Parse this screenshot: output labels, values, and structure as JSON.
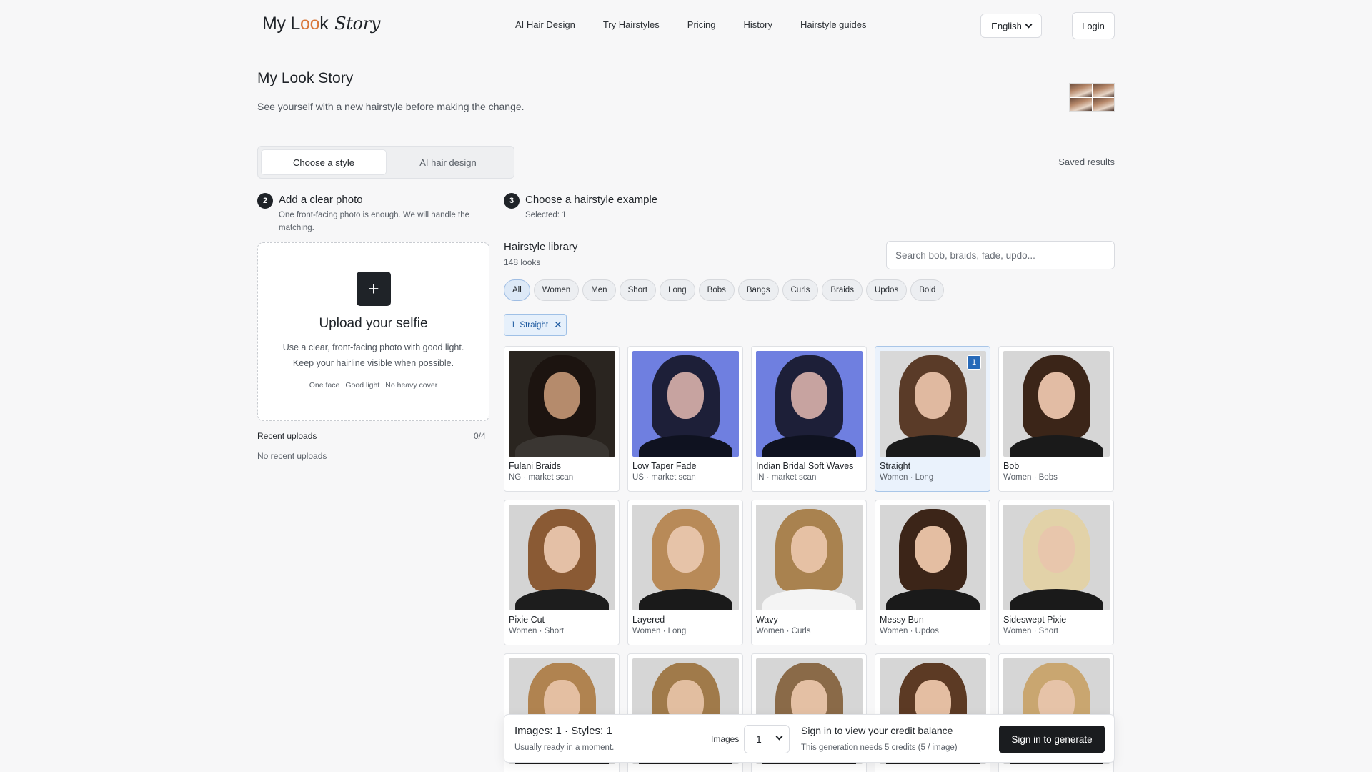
{
  "brand": {
    "logo_pre": "My L",
    "logo_oo": "oo",
    "logo_post": "k",
    "logo_story": "Story"
  },
  "nav": {
    "links": [
      "AI Hair Design",
      "Try Hairstyles",
      "Pricing",
      "History",
      "Hairstyle guides"
    ],
    "language": "English",
    "login": "Login"
  },
  "hero": {
    "title": "My Look Story",
    "subtitle": "See yourself with a new hairstyle before making the change."
  },
  "tabs": {
    "choose": "Choose a style",
    "ai": "AI hair design",
    "saved": "Saved results"
  },
  "step2": {
    "num": "2",
    "title": "Add a clear photo",
    "desc": "One front-facing photo is enough. We will handle the matching."
  },
  "step3": {
    "num": "3",
    "title": "Choose a hairstyle example",
    "selected": "Selected: 1"
  },
  "upload": {
    "plus": "+",
    "title": "Upload your selfie",
    "desc": "Use a clear, front-facing photo with good light. Keep your hairline visible when possible.",
    "tags": [
      "One face",
      "Good light",
      "No heavy cover"
    ]
  },
  "recent": {
    "label": "Recent uploads",
    "count": "0/4",
    "empty": "No recent uploads"
  },
  "library": {
    "title": "Hairstyle library",
    "count": "148 looks",
    "search_placeholder": "Search bob, braids, fade, updo...",
    "chips": [
      "All",
      "Women",
      "Men",
      "Short",
      "Long",
      "Bobs",
      "Bangs",
      "Curls",
      "Braids",
      "Updos",
      "Bold"
    ],
    "active_chip": "All",
    "selected_pill": {
      "num": "1",
      "label": "Straight"
    }
  },
  "cards": [
    {
      "name": "Fulani Braids",
      "meta": "NG · market scan",
      "bg": "#2a2520",
      "hair": "#1c1410",
      "face": "#b58b6c",
      "body": "#3a3632"
    },
    {
      "name": "Low Taper Fade",
      "meta": "US · market scan",
      "bg": "#6f7fe0",
      "hair": "#1d1f38",
      "face": "#c7a3a0",
      "body": "#0f1220"
    },
    {
      "name": "Indian Bridal Soft Waves",
      "meta": "IN · market scan",
      "bg": "#6f7fe0",
      "hair": "#1d1f38",
      "face": "#c7a3a0",
      "body": "#0f1220"
    },
    {
      "name": "Straight",
      "meta": "Women · Long",
      "bg": "#d8d8d8",
      "hair": "#5a3b28",
      "face": "#e0b9a0",
      "body": "#1a1a1a",
      "badge": "1",
      "selected": true
    },
    {
      "name": "Bob",
      "meta": "Women · Bobs",
      "bg": "#d6d6d6",
      "hair": "#3b2518",
      "face": "#e2bca4",
      "body": "#1a1a1a"
    },
    {
      "name": "Pixie Cut",
      "meta": "Women · Short",
      "bg": "#d4d4d4",
      "hair": "#8a5a34",
      "face": "#e4c0a6",
      "body": "#1d1d1d"
    },
    {
      "name": "Layered",
      "meta": "Women · Long",
      "bg": "#d6d6d6",
      "hair": "#b88a58",
      "face": "#e6c3a8",
      "body": "#1a1a1a"
    },
    {
      "name": "Wavy",
      "meta": "Women · Curls",
      "bg": "#d8d8d8",
      "hair": "#a9824f",
      "face": "#e6c1a4",
      "body": "#f4f4f4"
    },
    {
      "name": "Messy Bun",
      "meta": "Women · Updos",
      "bg": "#d6d6d6",
      "hair": "#3c2518",
      "face": "#e4bea2",
      "body": "#1a1a1a"
    },
    {
      "name": "Sideswept Pixie",
      "meta": "Women · Short",
      "bg": "#d6d6d6",
      "hair": "#e2d2a8",
      "face": "#e8c6ac",
      "body": "#1a1a1a"
    },
    {
      "name": "",
      "meta": "",
      "bg": "#d6d6d6",
      "hair": "#b08350",
      "face": "#e4bfa2",
      "body": "#1a1a1a"
    },
    {
      "name": "",
      "meta": "",
      "bg": "#d6d6d6",
      "hair": "#a07a4a",
      "face": "#e2bea0",
      "body": "#1a1a1a"
    },
    {
      "name": "",
      "meta": "",
      "bg": "#d6d6d6",
      "hair": "#8a6a48",
      "face": "#e4c0a4",
      "body": "#1a1a1a"
    },
    {
      "name": "",
      "meta": "",
      "bg": "#d6d6d6",
      "hair": "#5c3a24",
      "face": "#e4bea2",
      "body": "#1a1a1a"
    },
    {
      "name": "",
      "meta": "",
      "bg": "#d6d6d6",
      "hair": "#c9a670",
      "face": "#e6c3a8",
      "body": "#1a1a1a"
    }
  ],
  "bottom": {
    "title": "Images: 1 · Styles: 1",
    "sub": "Usually ready in a moment.",
    "images_label": "Images",
    "images_value": "1",
    "credit_title": "Sign in to view your credit balance",
    "credit_sub": "This generation needs 5 credits  (5 / image)",
    "button": "Sign in to generate"
  }
}
